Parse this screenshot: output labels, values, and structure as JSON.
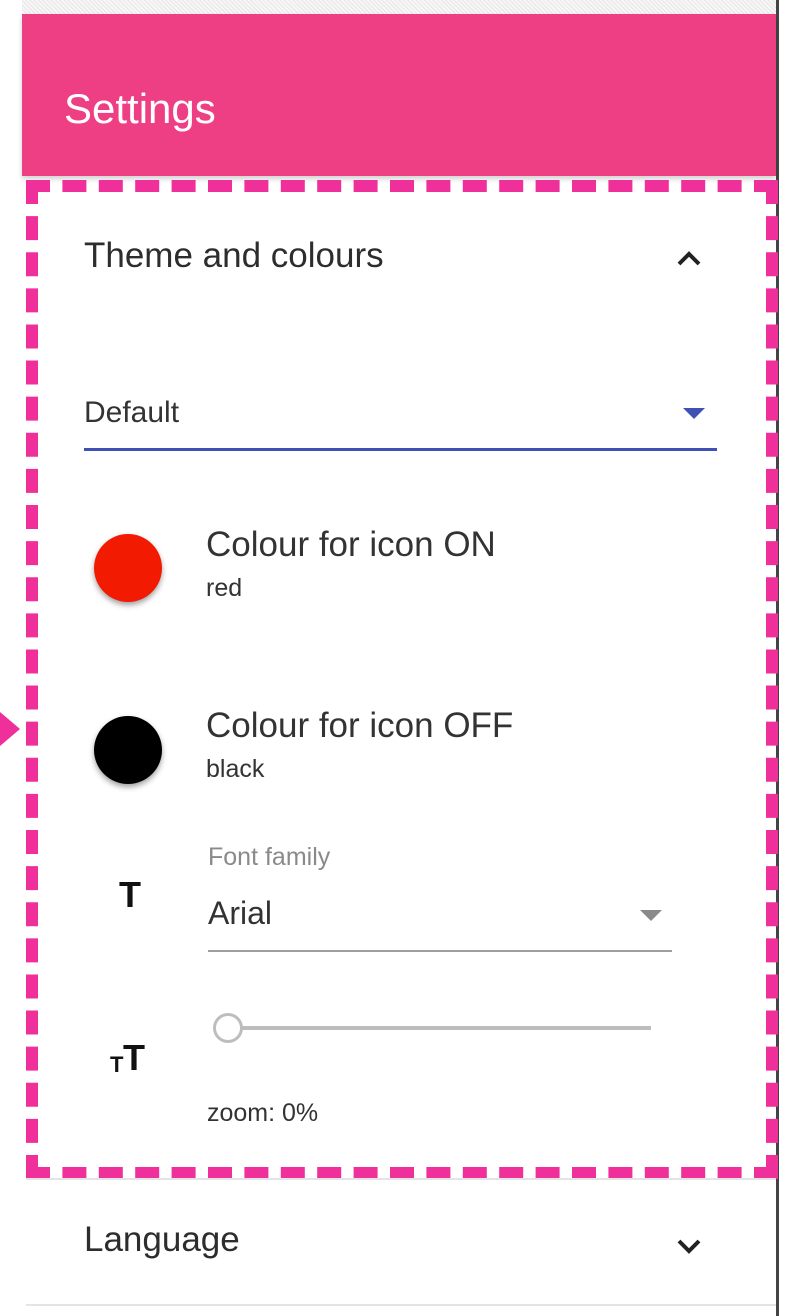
{
  "app_bar": {
    "title": "Settings",
    "color": "#ef3f84"
  },
  "theme_section": {
    "title": "Theme and colours",
    "expanded": true,
    "toggle_icon": "chevron-up-icon",
    "theme_select": {
      "value": "Default",
      "accent": "#3f51b5"
    },
    "icon_on": {
      "label": "Colour for icon ON",
      "value": "red",
      "swatch": "#f21a00"
    },
    "icon_off": {
      "label": "Colour for icon OFF",
      "value": "black",
      "swatch": "#000000"
    },
    "font_family": {
      "label": "Font family",
      "value": "Arial",
      "icon": "text-icon"
    },
    "zoom": {
      "icon": "format-size-icon",
      "level_percent": 0,
      "text": "zoom: 0%"
    }
  },
  "language_section": {
    "title": "Language",
    "expanded": false,
    "toggle_icon": "chevron-down-icon"
  },
  "highlight_color": "#ef2f9a"
}
